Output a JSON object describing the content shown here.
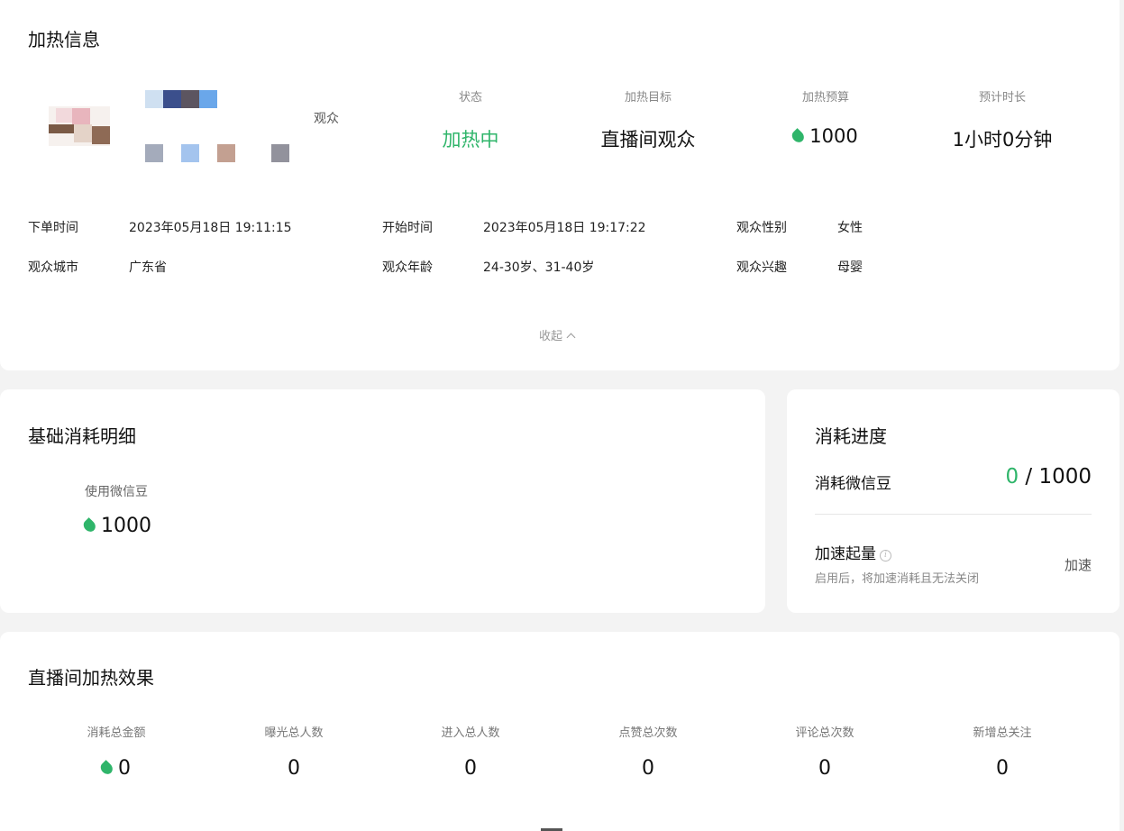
{
  "info": {
    "title": "加热信息",
    "audience_suffix": "观众",
    "stats": [
      {
        "label": "状态",
        "value": "加热中"
      },
      {
        "label": "加热目标",
        "value": "直播间观众"
      },
      {
        "label": "加热预算",
        "value": "1000"
      },
      {
        "label": "预计时长",
        "value": "1小时0分钟"
      }
    ],
    "meta": [
      {
        "label": "下单时间",
        "value": "2023年05月18日 19:11:15"
      },
      {
        "label": "开始时间",
        "value": "2023年05月18日 19:17:22"
      },
      {
        "label": "观众性别",
        "value": "女性"
      },
      {
        "label": "观众城市",
        "value": "广东省"
      },
      {
        "label": "观众年龄",
        "value": "24-30岁、31-40岁"
      },
      {
        "label": "观众兴趣",
        "value": "母婴"
      }
    ],
    "collapse_label": "收起"
  },
  "basic": {
    "title": "基础消耗明细",
    "label": "使用微信豆",
    "value": "1000"
  },
  "progress": {
    "title": "消耗进度",
    "label": "消耗微信豆",
    "current": "0",
    "separator": " / ",
    "total": "1000",
    "speed_title": "加速起量",
    "speed_desc": "启用后，将加速消耗且无法关闭",
    "speed_button": "加速"
  },
  "effect": {
    "title": "直播间加热效果",
    "metrics": [
      {
        "label": "消耗总金额",
        "value": "0"
      },
      {
        "label": "曝光总人数",
        "value": "0"
      },
      {
        "label": "进入总人数",
        "value": "0"
      },
      {
        "label": "点赞总次数",
        "value": "0"
      },
      {
        "label": "评论总次数",
        "value": "0"
      },
      {
        "label": "新增总关注",
        "value": "0"
      }
    ]
  },
  "colors": {
    "accent": "#2fb56a",
    "background": "#f3f3f3",
    "card": "#ffffff"
  },
  "icons": {
    "bean": "wechat-bean-icon",
    "info": "info-icon",
    "collapse": "chevron-up-icon"
  }
}
